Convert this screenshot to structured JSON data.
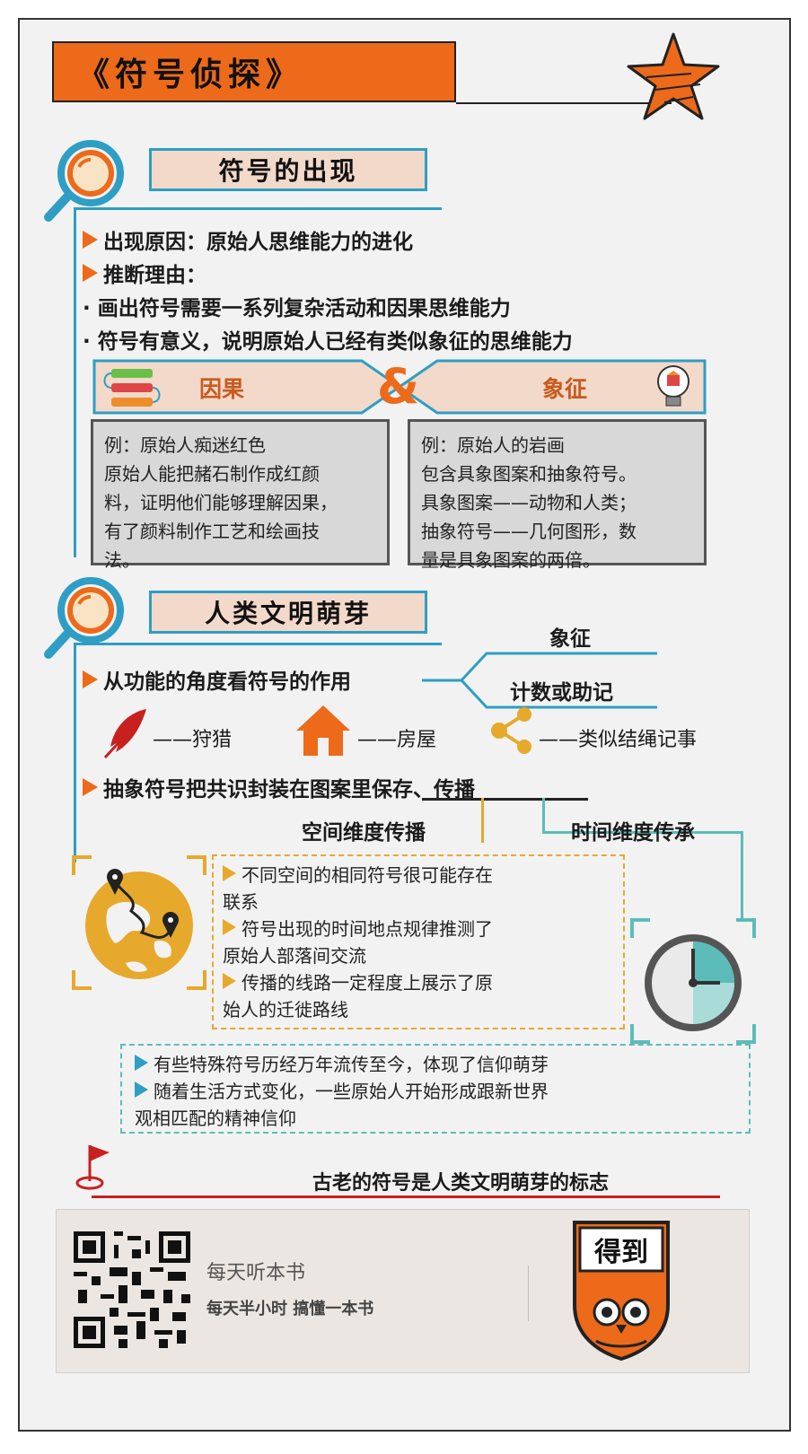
{
  "title": "《符号侦探》",
  "section1": {
    "heading": "符号的出现",
    "bullet1": "出现原因：原始人思维能力的进化",
    "bullet2": "推断理由：",
    "dot1": "· 画出符号需要一系列复杂活动和因果思维能力",
    "dot2": "· 符号有意义，说明原始人已经有类似象征的思维能力",
    "band": {
      "left": "因果",
      "amp": "&",
      "right": "象征"
    },
    "box_left": [
      "例：原始人痴迷红色",
      "原始人能把赭石制作成红颜",
      "料，证明他们能够理解因果，",
      "有了颜料制作工艺和绘画技",
      "法。"
    ],
    "box_right": [
      "例：原始人的岩画",
      "包含具象图案和抽象符号。",
      "具象图案——动物和人类；",
      "抽象符号——几何图形，数",
      "量是具象图案的两倍。"
    ]
  },
  "section2": {
    "heading": "人类文明萌芽",
    "bullet1": "从功能的角度看符号的作用",
    "branch_top": "象征",
    "branch_bottom": "计数或助记",
    "icons": [
      {
        "icon": "feather-icon",
        "label": "——狩猎"
      },
      {
        "icon": "house-icon",
        "label": "——房屋"
      },
      {
        "icon": "share-icon",
        "label": "——类似结绳记事"
      }
    ],
    "bullet2": "抽象符号把共识封装在图案里保存、传播",
    "space_label": "空间维度传播",
    "time_label": "时间维度传承",
    "space_items": [
      "不同空间的相同符号很可能存在",
      "联系",
      "符号出现的时间地点规律推测了",
      "原始人部落间交流",
      "传播的线路一定程度上展示了原",
      "始人的迁徙路线"
    ],
    "time_items": [
      "有些特殊符号历经万年流传至今，体现了信仰萌芽",
      "随着生活方式变化，一些原始人开始形成跟新世界",
      "观相匹配的精神信仰"
    ]
  },
  "conclusion": "古老的符号是人类文明萌芽的标志",
  "footer": {
    "line1": "每天听本书",
    "line2": "每天半小时  搞懂一本书",
    "logo": "得到"
  },
  "colors": {
    "orange": "#ec6a1a",
    "teal": "#2e9ec4",
    "yellow": "#e6a92b",
    "peach": "#f3d9ca"
  }
}
